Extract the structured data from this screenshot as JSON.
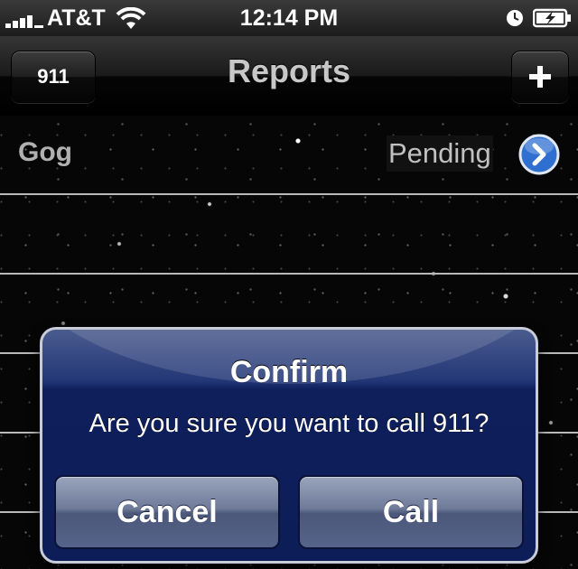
{
  "status_bar": {
    "carrier": "AT&T",
    "time": "12:14 PM",
    "icons": [
      "signal-bars-icon",
      "wifi-icon",
      "clock-icon",
      "battery-charging-icon"
    ]
  },
  "nav": {
    "left_button": "911",
    "title": "Reports",
    "right_button_icon": "plus-icon"
  },
  "reports": [
    {
      "name": "Gog",
      "status": "Pending",
      "accessory_icon": "chevron-right-icon"
    }
  ],
  "alert": {
    "title": "Confirm",
    "message": "Are you sure you want to call 911?",
    "cancel_label": "Cancel",
    "confirm_label": "Call"
  },
  "colors": {
    "alert_blue": "#0c1d58",
    "disclosure_blue": "#2f6fd0"
  }
}
